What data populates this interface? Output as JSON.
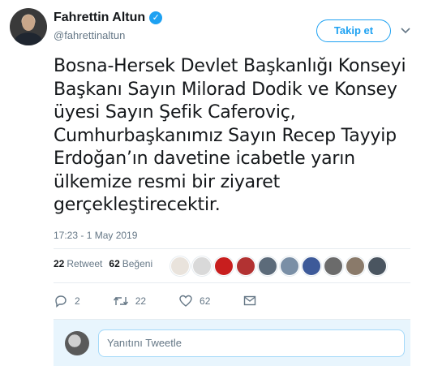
{
  "user": {
    "display_name": "Fahrettin Altun",
    "handle": "@fahrettinaltun",
    "verified_icon": "verified-badge-icon"
  },
  "follow_button_label": "Takip et",
  "tweet": {
    "lines": [
      "Bosna-Hersek Devlet Başkanlığı Konseyi",
      "Başkanı Sayın Milorad Dodik ve Konsey",
      "üyesi Sayın Şefik Caferoviç,",
      "Cumhurbaşkanımız Sayın Recep Tayyip",
      "Erdoğan’ın davetine icabetle yarın",
      "ülkemize resmi bir ziyaret",
      "gerçekleştirecektir."
    ],
    "timestamp": "17:23 - 1 May 2019"
  },
  "stats": {
    "retweet_count": "22",
    "retweet_label": "Retweet",
    "like_count": "62",
    "like_label": "Beğeni"
  },
  "liker_avatars": [
    {
      "color": "#e9e3dc"
    },
    {
      "color": "#d9d9d9"
    },
    {
      "color": "#c81e1e"
    },
    {
      "color": "#b23232"
    },
    {
      "color": "#5c6b7a"
    },
    {
      "color": "#7a8fa6"
    },
    {
      "color": "#3d5a99"
    },
    {
      "color": "#6b6b6b"
    },
    {
      "color": "#8a7a6a"
    },
    {
      "color": "#4a5560"
    }
  ],
  "actions": {
    "reply_count": "2",
    "retweet_count": "22",
    "like_count": "62"
  },
  "reply": {
    "placeholder": "Yanıtını Tweetle"
  },
  "colors": {
    "accent": "#1da1f2",
    "text_secondary": "#657786",
    "reply_background": "#e8f5fd"
  }
}
